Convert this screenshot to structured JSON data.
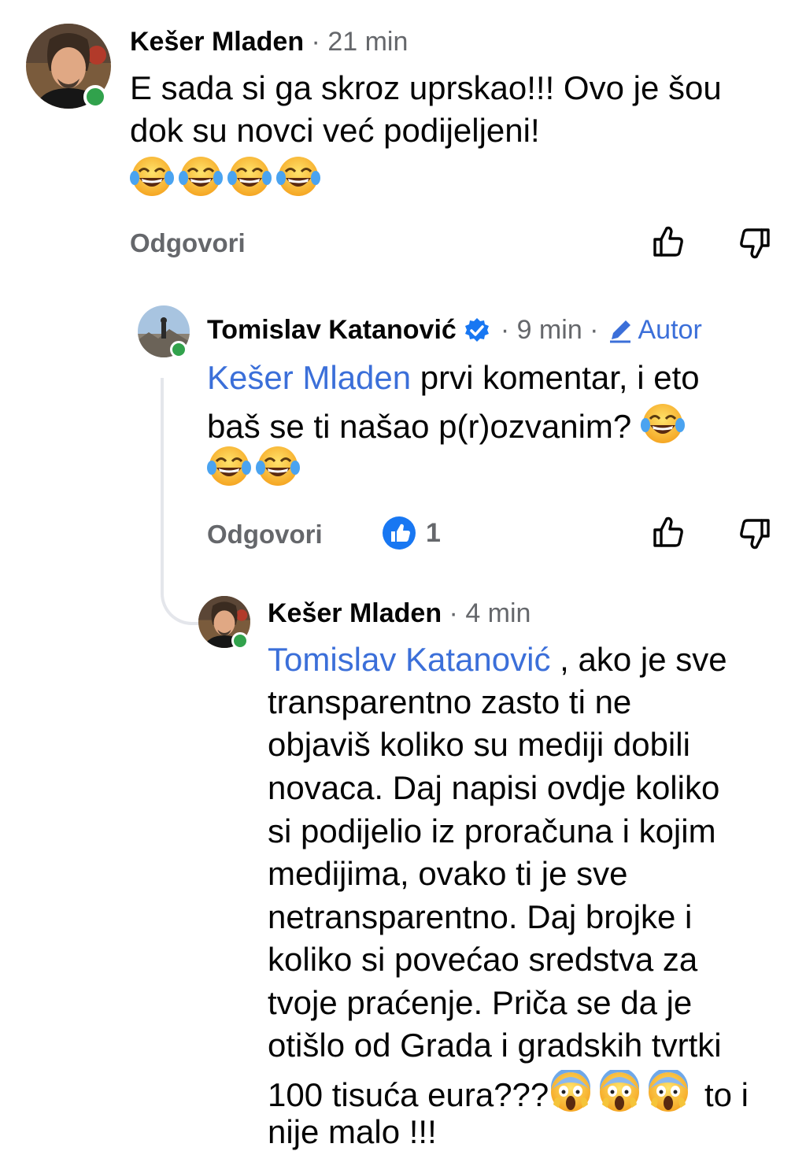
{
  "comments": [
    {
      "author": "Kešer Mladen",
      "time": "· 21 min",
      "lines": [
        "E sada si ga skroz uprskao!!! Ovo je šou",
        "dok su novci već podijeljeni!"
      ],
      "emojis": [
        "laughing-tears",
        "laughing-tears",
        "laughing-tears",
        "laughing-tears"
      ],
      "reply_label": "Odgovori"
    },
    {
      "author": "Tomislav Katanović",
      "verified": true,
      "time": "· 9 min ·",
      "author_badge": "Autor",
      "mention": "Kešer Mladen",
      "line1_rest": " prvi komentar, i eto",
      "line2": "baš se ti našao p(r)ozvanim?",
      "reply_label": "Odgovori",
      "like_count": "1"
    },
    {
      "author": "Kešer Mladen",
      "time": "· 4 min",
      "mention": "Tomislav Katanović",
      "line1_rest": " , ako je sve",
      "lines": [
        "transparentno zasto ti ne",
        "objaviš koliko su mediji dobili",
        "novaca. Daj napisi ovdje koliko",
        "si podijelio iz proračuna i kojim",
        "medijima, ovako ti je sve",
        "netransparentno. Daj brojke i",
        "koliko si povećao sredstva za",
        "tvoje praćenje. Priča se da je",
        "otišlo od Grada i gradskih tvrtki"
      ],
      "line_emoji_prefix": "100 tisuća eura???",
      "line_emoji_suffix": " to i",
      "last_line": "nije malo !!!"
    }
  ],
  "colors": {
    "online": "#31a24c",
    "mention": "#3b6fd9",
    "verified": "#1877f2",
    "meta": "#65676b"
  },
  "icons": [
    "thumbs-up-outline-icon",
    "thumbs-down-outline-icon",
    "verified-badge-icon",
    "pencil-icon",
    "like-reaction-icon",
    "face-screaming-in-fear-emoji",
    "face-with-tears-of-joy-emoji"
  ]
}
